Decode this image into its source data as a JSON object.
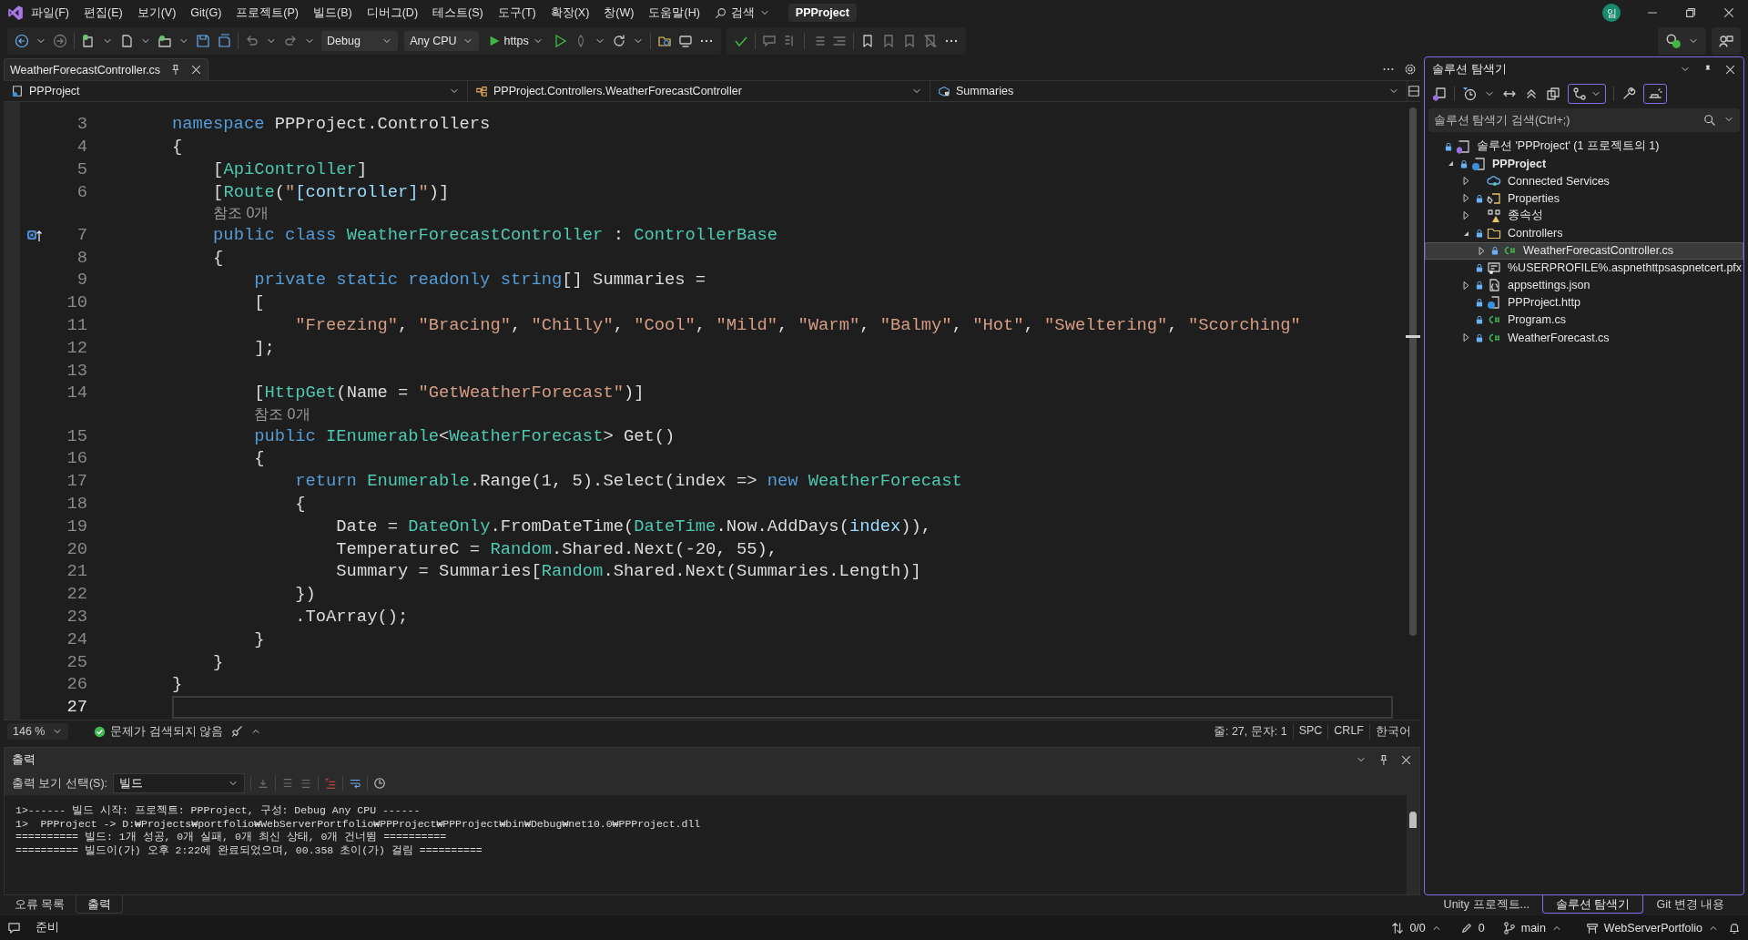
{
  "menu_bar": {
    "items": [
      "파일(F)",
      "편집(E)",
      "보기(V)",
      "Git(G)",
      "프로젝트(P)",
      "빌드(B)",
      "디버그(D)",
      "테스트(S)",
      "도구(T)",
      "확장(X)",
      "창(W)",
      "도움말(H)"
    ],
    "search": "검색",
    "solution_title": "PPProject",
    "avatar": "임"
  },
  "toolbar": {
    "configuration": "Debug",
    "platform": "Any CPU",
    "run_target": "https"
  },
  "editor": {
    "tab": "WeatherForecastController.cs",
    "nav": [
      "PPProject",
      "PPProject.Controllers.WeatherForecastController",
      "Summaries"
    ],
    "lines": [
      {
        "kind": "code",
        "number": "3",
        "current": false,
        "marker": false,
        "tokens": [
          {
            "kind": "keyword",
            "text": "namespace"
          },
          {
            "kind": "plain",
            "text": " PPProject.Controllers"
          }
        ]
      },
      {
        "kind": "code",
        "number": "4",
        "current": false,
        "marker": false,
        "tokens": [
          {
            "kind": "plain",
            "text": "{"
          }
        ]
      },
      {
        "kind": "code",
        "number": "5",
        "current": false,
        "marker": false,
        "tokens": [
          {
            "kind": "plain",
            "text": "    ["
          },
          {
            "kind": "type",
            "text": "ApiController"
          },
          {
            "kind": "plain",
            "text": "]"
          }
        ]
      },
      {
        "kind": "code",
        "number": "6",
        "current": false,
        "marker": false,
        "tokens": [
          {
            "kind": "plain",
            "text": "    ["
          },
          {
            "kind": "type",
            "text": "Route"
          },
          {
            "kind": "plain",
            "text": "("
          },
          {
            "kind": "string",
            "text": "\""
          },
          {
            "kind": "parameter",
            "text": "[controller]"
          },
          {
            "kind": "string",
            "text": "\""
          },
          {
            "kind": "plain",
            "text": ")]"
          }
        ]
      },
      {
        "kind": "codelens",
        "text": "    참조 0개"
      },
      {
        "kind": "code",
        "number": "7",
        "current": false,
        "marker": true,
        "tokens": [
          {
            "kind": "keyword",
            "text": "    public class "
          },
          {
            "kind": "type",
            "text": "WeatherForecastController"
          },
          {
            "kind": "plain",
            "text": " : "
          },
          {
            "kind": "type",
            "text": "ControllerBase"
          }
        ]
      },
      {
        "kind": "code",
        "number": "8",
        "current": false,
        "marker": false,
        "tokens": [
          {
            "kind": "plain",
            "text": "    {"
          }
        ]
      },
      {
        "kind": "code",
        "number": "9",
        "current": false,
        "marker": false,
        "tokens": [
          {
            "kind": "keyword",
            "text": "        private static readonly string"
          },
          {
            "kind": "plain",
            "text": "[] Summaries ="
          }
        ]
      },
      {
        "kind": "code",
        "number": "10",
        "current": false,
        "marker": false,
        "tokens": [
          {
            "kind": "plain",
            "text": "        ["
          }
        ]
      },
      {
        "kind": "code",
        "number": "11",
        "current": false,
        "marker": false,
        "tokens": [
          {
            "kind": "string",
            "text": "            \"Freezing\""
          },
          {
            "kind": "plain",
            "text": ", "
          },
          {
            "kind": "string",
            "text": "\"Bracing\""
          },
          {
            "kind": "plain",
            "text": ", "
          },
          {
            "kind": "string",
            "text": "\"Chilly\""
          },
          {
            "kind": "plain",
            "text": ", "
          },
          {
            "kind": "string",
            "text": "\"Cool\""
          },
          {
            "kind": "plain",
            "text": ", "
          },
          {
            "kind": "string",
            "text": "\"Mild\""
          },
          {
            "kind": "plain",
            "text": ", "
          },
          {
            "kind": "string",
            "text": "\"Warm\""
          },
          {
            "kind": "plain",
            "text": ", "
          },
          {
            "kind": "string",
            "text": "\"Balmy\""
          },
          {
            "kind": "plain",
            "text": ", "
          },
          {
            "kind": "string",
            "text": "\"Hot\""
          },
          {
            "kind": "plain",
            "text": ", "
          },
          {
            "kind": "string",
            "text": "\"Sweltering\""
          },
          {
            "kind": "plain",
            "text": ", "
          },
          {
            "kind": "string",
            "text": "\"Scorching\""
          }
        ]
      },
      {
        "kind": "code",
        "number": "12",
        "current": false,
        "marker": false,
        "tokens": [
          {
            "kind": "plain",
            "text": "        ];"
          }
        ]
      },
      {
        "kind": "code",
        "number": "13",
        "current": false,
        "marker": false
      },
      {
        "kind": "code",
        "number": "14",
        "current": false,
        "marker": false,
        "tokens": [
          {
            "kind": "plain",
            "text": "        ["
          },
          {
            "kind": "type",
            "text": "HttpGet"
          },
          {
            "kind": "plain",
            "text": "(Name = "
          },
          {
            "kind": "string",
            "text": "\"GetWeatherForecast\""
          },
          {
            "kind": "plain",
            "text": ")]"
          }
        ]
      },
      {
        "kind": "codelens",
        "text": "        참조 0개"
      },
      {
        "kind": "code",
        "number": "15",
        "current": false,
        "marker": false,
        "tokens": [
          {
            "kind": "keyword",
            "text": "        public "
          },
          {
            "kind": "type",
            "text": "IEnumerable"
          },
          {
            "kind": "plain",
            "text": "<"
          },
          {
            "kind": "type",
            "text": "WeatherForecast"
          },
          {
            "kind": "plain",
            "text": "> Get()"
          }
        ]
      },
      {
        "kind": "code",
        "number": "16",
        "current": false,
        "marker": false,
        "tokens": [
          {
            "kind": "plain",
            "text": "        {"
          }
        ]
      },
      {
        "kind": "code",
        "number": "17",
        "current": false,
        "marker": false,
        "tokens": [
          {
            "kind": "keyword",
            "text": "            return "
          },
          {
            "kind": "type",
            "text": "Enumerable"
          },
          {
            "kind": "plain",
            "text": ".Range(1, 5).Select(index => "
          },
          {
            "kind": "keyword",
            "text": "new "
          },
          {
            "kind": "type",
            "text": "WeatherForecast"
          }
        ]
      },
      {
        "kind": "code",
        "number": "18",
        "current": false,
        "marker": false,
        "tokens": [
          {
            "kind": "plain",
            "text": "            {"
          }
        ]
      },
      {
        "kind": "code",
        "number": "19",
        "current": false,
        "marker": false,
        "tokens": [
          {
            "kind": "plain",
            "text": "                Date = "
          },
          {
            "kind": "type",
            "text": "DateOnly"
          },
          {
            "kind": "plain",
            "text": ".FromDateTime("
          },
          {
            "kind": "type",
            "text": "DateTime"
          },
          {
            "kind": "plain",
            "text": ".Now.AddDays("
          },
          {
            "kind": "parameter",
            "text": "index"
          },
          {
            "kind": "plain",
            "text": ")),"
          }
        ]
      },
      {
        "kind": "code",
        "number": "20",
        "current": false,
        "marker": false,
        "tokens": [
          {
            "kind": "plain",
            "text": "                TemperatureC = "
          },
          {
            "kind": "type",
            "text": "Random"
          },
          {
            "kind": "plain",
            "text": ".Shared.Next(-20, 55),"
          }
        ]
      },
      {
        "kind": "code",
        "number": "21",
        "current": false,
        "marker": false,
        "tokens": [
          {
            "kind": "plain",
            "text": "                Summary = Summaries["
          },
          {
            "kind": "type",
            "text": "Random"
          },
          {
            "kind": "plain",
            "text": ".Shared.Next(Summaries.Length)]"
          }
        ]
      },
      {
        "kind": "code",
        "number": "22",
        "current": false,
        "marker": false,
        "tokens": [
          {
            "kind": "plain",
            "text": "            })"
          }
        ]
      },
      {
        "kind": "code",
        "number": "23",
        "current": false,
        "marker": false,
        "tokens": [
          {
            "kind": "plain",
            "text": "            .ToArray();"
          }
        ]
      },
      {
        "kind": "code",
        "number": "24",
        "current": false,
        "marker": false,
        "tokens": [
          {
            "kind": "plain",
            "text": "        }"
          }
        ]
      },
      {
        "kind": "code",
        "number": "25",
        "current": false,
        "marker": false,
        "tokens": [
          {
            "kind": "plain",
            "text": "    }"
          }
        ]
      },
      {
        "kind": "code",
        "number": "26",
        "current": false,
        "marker": false,
        "tokens": [
          {
            "kind": "plain",
            "text": "}"
          }
        ]
      },
      {
        "kind": "code",
        "number": "27",
        "current": true,
        "marker": false
      }
    ],
    "status": {
      "zoom": "146 %",
      "issues": "문제가 검색되지 않음",
      "position": "줄: 27, 문자: 1",
      "whitespace": "SPC",
      "line_ending": "CRLF",
      "language": "한국어"
    }
  },
  "output": {
    "title": "출력",
    "source_label": "출력 보기 선택(S):",
    "source": "빌드",
    "lines": [
      "1>------ 빌드 시작: 프로젝트: PPProject, 구성: Debug Any CPU ------",
      "1>  PPProject -> D:₩Projects₩portfolio₩WebServerPortfolio₩PPProject₩PPProject₩bin₩Debug₩net10.0₩PPProject.dll",
      "========== 빌드: 1개 성공, 0개 실패, 0개 최신 상태, 0개 건너뜀 ==========",
      "========== 빌드이(가) 오후 2:22에 완료되었으며, 00.358 초이(가) 걸림 =========="
    ],
    "tabs": [
      {
        "label": "오류 목록",
        "selected": false
      },
      {
        "label": "출력",
        "selected": true
      }
    ]
  },
  "solution_explorer": {
    "title": "솔루션 탐색기",
    "search": {
      "placeholder": "솔루션 탐색기 검색(Ctrl+;)"
    },
    "tree": [
      {
        "label": "솔루션 'PPProject' (1 프로젝트의 1)",
        "kind": "solution",
        "locked": true,
        "selected": false,
        "children": [
          {
            "label": "PPProject",
            "kind": "project",
            "locked": true,
            "selected": false,
            "expanded": true,
            "children": [
              {
                "label": "Connected Services",
                "kind": "service",
                "locked": false,
                "selected": false,
                "expanded": false
              },
              {
                "label": "Properties",
                "kind": "properties",
                "locked": true,
                "selected": false,
                "expanded": false
              },
              {
                "label": "종속성",
                "kind": "dependencies",
                "locked": false,
                "selected": false,
                "expanded": false
              },
              {
                "label": "Controllers",
                "kind": "folder",
                "locked": true,
                "selected": false,
                "expanded": true,
                "children": [
                  {
                    "label": "WeatherForecastController.cs",
                    "kind": "csharp",
                    "locked": true,
                    "selected": true,
                    "expanded": false
                  }
                ]
              },
              {
                "label": "%USERPROFILE%.aspnethttpsaspnetcert.pfx",
                "kind": "certificate",
                "locked": true,
                "selected": false
              },
              {
                "label": "appsettings.json",
                "kind": "json",
                "locked": true,
                "selected": false,
                "expanded": false
              },
              {
                "label": "PPProject.http",
                "kind": "http",
                "locked": true,
                "selected": false
              },
              {
                "label": "Program.cs",
                "kind": "csharp",
                "locked": true,
                "selected": false
              },
              {
                "label": "WeatherForecast.cs",
                "kind": "csharp",
                "locked": true,
                "selected": false,
                "expanded": false
              }
            ]
          }
        ]
      }
    ],
    "tabs": [
      {
        "label": "Unity 프로젝트...",
        "selected": false
      },
      {
        "label": "솔루션 탐색기",
        "selected": true
      },
      {
        "label": "Git 변경 내용",
        "selected": false
      }
    ]
  },
  "status_bar": {
    "message": "준비",
    "sync": "0/0",
    "changes": "0",
    "branch": "main",
    "repository": "WebServerPortfolio"
  }
}
